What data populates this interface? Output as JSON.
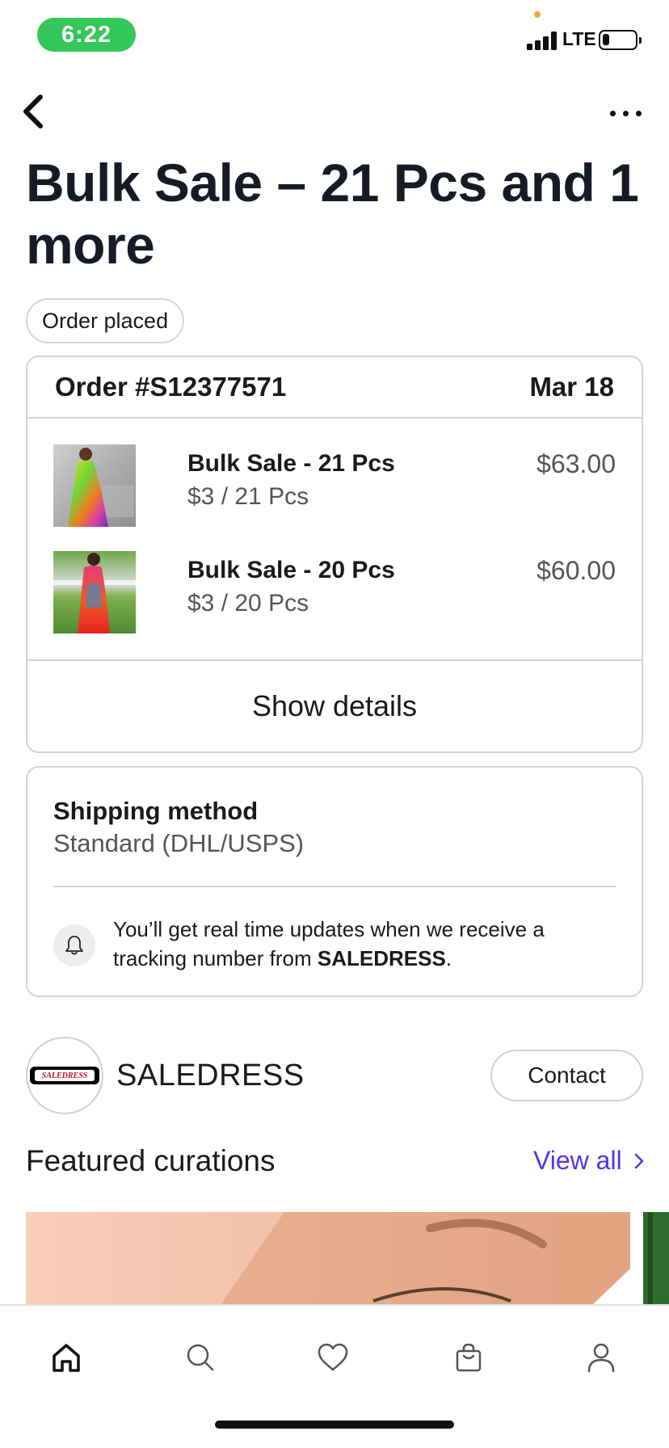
{
  "status_bar": {
    "time": "6:22",
    "network": "LTE",
    "battery_level": 0.2,
    "time_pill_color": "#34c759"
  },
  "nav": {
    "back_icon": "chevron-left-icon",
    "more_icon": "more-horizontal-icon"
  },
  "page": {
    "title": "Bulk Sale – 21 Pcs and 1 more",
    "status": "Order placed"
  },
  "order": {
    "number": "Order #S12377571",
    "date": "Mar 18",
    "items": [
      {
        "name": "Bulk Sale - 21 Pcs",
        "unit": "$3 / 21 Pcs",
        "price": "$63.00"
      },
      {
        "name": "Bulk Sale - 20 Pcs",
        "unit": "$3 / 20 Pcs",
        "price": "$60.00"
      }
    ],
    "show_details": "Show details"
  },
  "shipping": {
    "title": "Shipping method",
    "value": "Standard (DHL/USPS)",
    "notice_prefix": "You’ll get real time updates when we receive a tracking number from ",
    "notice_seller": "SALEDRESS",
    "notice_suffix": ".",
    "bell_icon": "bell-icon"
  },
  "seller": {
    "name": "SALEDRESS",
    "logo_text": "SALEDRESS",
    "contact": "Contact"
  },
  "featured": {
    "title": "Featured curations",
    "view_all": "View all"
  },
  "tab_bar": {
    "tabs": [
      "home-icon",
      "search-icon",
      "heart-icon",
      "shopping-bag-icon",
      "profile-icon"
    ],
    "active": "home-icon"
  },
  "colors": {
    "accent": "#5433eb",
    "text": "#1a1a1a",
    "muted": "#555555",
    "border": "#d4d4d4"
  }
}
